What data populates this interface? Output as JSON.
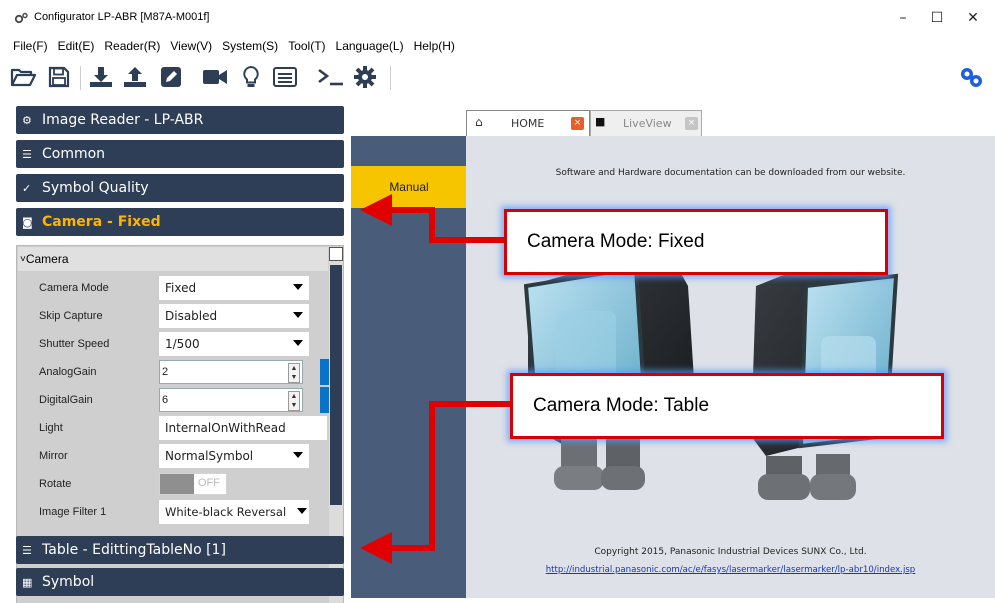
{
  "window": {
    "title": "Configurator LP-ABR [M87A-M001f]",
    "controls": {
      "minimize": "–",
      "maximize": "☐",
      "close": "✕"
    }
  },
  "menu": [
    "File(F)",
    "Edit(E)",
    "Reader(R)",
    "View(V)",
    "System(S)",
    "Tool(T)",
    "Language(L)",
    "Help(H)"
  ],
  "toolbar": {
    "icons": [
      "open-folder-icon",
      "save-icon",
      "download-icon",
      "upload-icon",
      "edit-icon",
      "camera-icon",
      "lightbulb-icon",
      "list-icon",
      "terminal-icon",
      "settings-icon",
      "connect-icon"
    ]
  },
  "sections": [
    {
      "label": "Image Reader - LP-ABR",
      "icon": "gears-icon"
    },
    {
      "label": "Common",
      "icon": "list-icon"
    },
    {
      "label": "Symbol Quality",
      "icon": "quality-icon"
    },
    {
      "label": "Camera - Fixed",
      "icon": "camera-icon",
      "active": true
    },
    {
      "label": "Table - EdittingTableNo [1]",
      "icon": "table-icon"
    },
    {
      "label": "Symbol",
      "icon": "barcode-icon"
    }
  ],
  "camera_group": {
    "label": "Camera",
    "properties": [
      {
        "label": "Camera Mode",
        "value": "Fixed",
        "type": "dropdown"
      },
      {
        "label": "Skip Capture",
        "value": "Disabled",
        "type": "dropdown"
      },
      {
        "label": "Shutter Speed",
        "value": "1/500",
        "type": "dropdown"
      },
      {
        "label": "AnalogGain",
        "value": "2",
        "type": "numeric"
      },
      {
        "label": "DigitalGain",
        "value": "6",
        "type": "numeric"
      },
      {
        "label": "Light",
        "value": "InternalOnWithRead",
        "type": "text"
      },
      {
        "label": "Mirror",
        "value": "NormalSymbol",
        "type": "dropdown"
      },
      {
        "label": "Rotate",
        "value": "OFF",
        "type": "toggle"
      },
      {
        "label": "Image Filter 1",
        "value": "White-black Reversal",
        "type": "dropdown"
      }
    ]
  },
  "side_nav": {
    "manual_label": "Manual"
  },
  "tabs": [
    {
      "label": "HOME",
      "active": true
    },
    {
      "label": "LiveView",
      "active": false
    }
  ],
  "home": {
    "doc_text": "Software and Hardware documentation can be downloaded from our website.",
    "copyright": "Copyright 2015, Panasonic Industrial Devices SUNX Co., Ltd.",
    "url": "http://industrial.panasonic.com/ac/e/fasys/lasermarker/lasermarker/lp-abr10/index.jsp"
  },
  "annotations": {
    "fixed": "Camera Mode: Fixed",
    "table": "Camera Mode: Table"
  },
  "colors": {
    "panel_dark": "#2e3e57",
    "accent_yellow": "#f7c400",
    "active_label": "#ffb400",
    "annotation_red": "#d50000",
    "slider_blue": "#0a72c9"
  }
}
